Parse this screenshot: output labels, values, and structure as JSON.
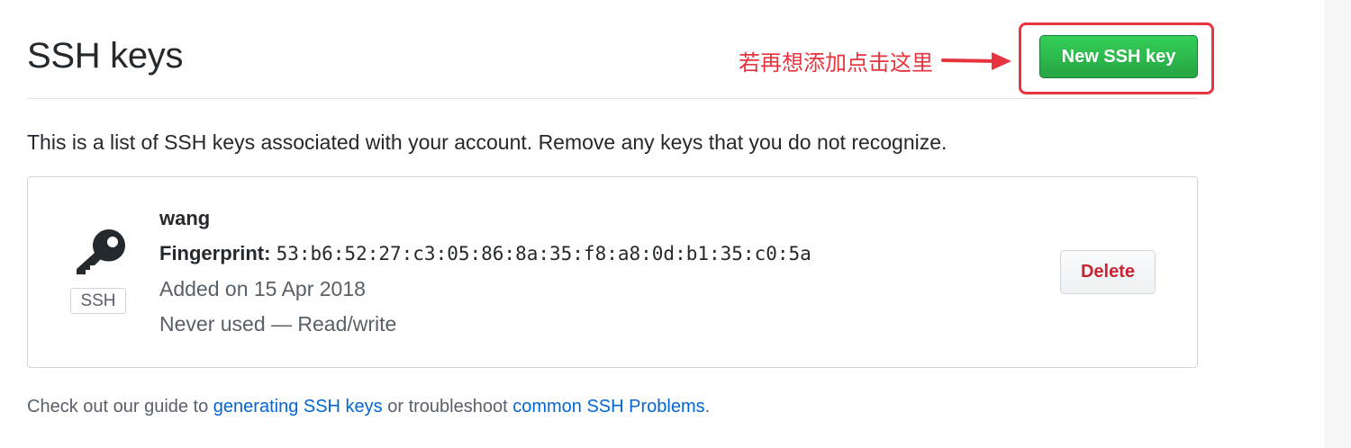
{
  "header": {
    "title": "SSH keys",
    "new_key_button_label": "New SSH key"
  },
  "annotation": {
    "text": "若再想添加点击这里",
    "color": "#e8343f",
    "arrow_icon": "arrow-right-icon"
  },
  "intro": {
    "text": "This is a list of SSH keys associated with your account. Remove any keys that you do not recognize."
  },
  "keys": [
    {
      "icon": "key-icon",
      "type_label": "SSH",
      "title": "wang",
      "fingerprint_label": "Fingerprint:",
      "fingerprint": "53:b6:52:27:c3:05:86:8a:35:f8:a8:0d:b1:35:c0:5a",
      "added": "Added on 15 Apr 2018",
      "usage": "Never used — Read/write",
      "delete_label": "Delete"
    }
  ],
  "footer": {
    "prefix": "Check out our guide to ",
    "link1": "generating SSH keys",
    "middle": " or troubleshoot ",
    "link2": "common SSH Problems",
    "suffix": "."
  },
  "colors": {
    "primary_button": "#28a745",
    "danger": "#cb2431",
    "link": "#0366d6",
    "annotation": "#e8343f"
  }
}
